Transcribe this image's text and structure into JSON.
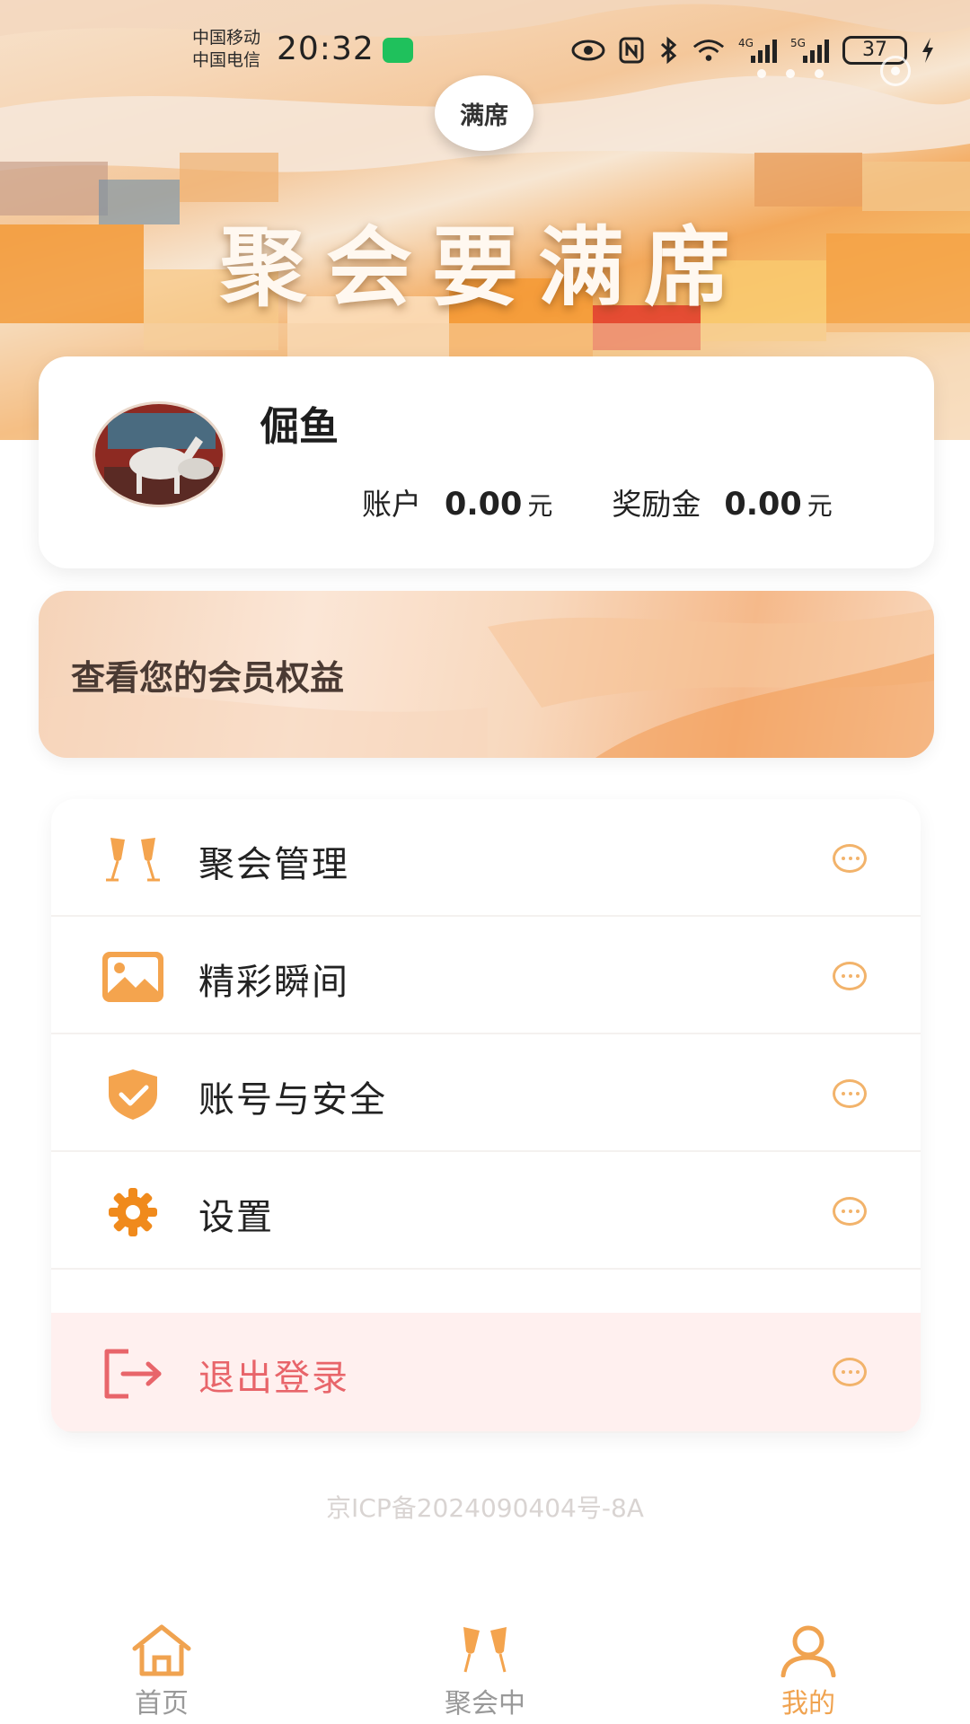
{
  "status_bar": {
    "carrier_1": "中国移动",
    "carrier_2": "中国电信",
    "time": "20:32",
    "network_1": "4G",
    "network_2": "5G",
    "battery": "37"
  },
  "header": {
    "logo_text": "满席",
    "title": "聚会要满席"
  },
  "profile": {
    "username": "倔鱼",
    "account_label": "账户",
    "account_value": "0.00",
    "account_unit": "元",
    "bonus_label": "奖励金",
    "bonus_value": "0.00",
    "bonus_unit": "元"
  },
  "member_banner": {
    "text": "查看您的会员权益"
  },
  "menu": {
    "items": [
      {
        "label": "聚会管理",
        "icon": "champagne-glasses-icon"
      },
      {
        "label": "精彩瞬间",
        "icon": "image-icon"
      },
      {
        "label": "账号与安全",
        "icon": "shield-check-icon"
      },
      {
        "label": "设置",
        "icon": "gear-icon"
      }
    ],
    "logout_label": "退出登录"
  },
  "footer": {
    "icp": "京ICP备2024090404号-8A"
  },
  "tabbar": {
    "tabs": [
      {
        "label": "首页",
        "icon": "home-icon",
        "active": false
      },
      {
        "label": "聚会中",
        "icon": "champagne-glasses-icon",
        "active": false
      },
      {
        "label": "我的",
        "icon": "user-icon",
        "active": true
      }
    ]
  },
  "colors": {
    "accent": "#f0a350",
    "logout_red": "#e8656a",
    "logout_bg": "#fff0ef"
  }
}
